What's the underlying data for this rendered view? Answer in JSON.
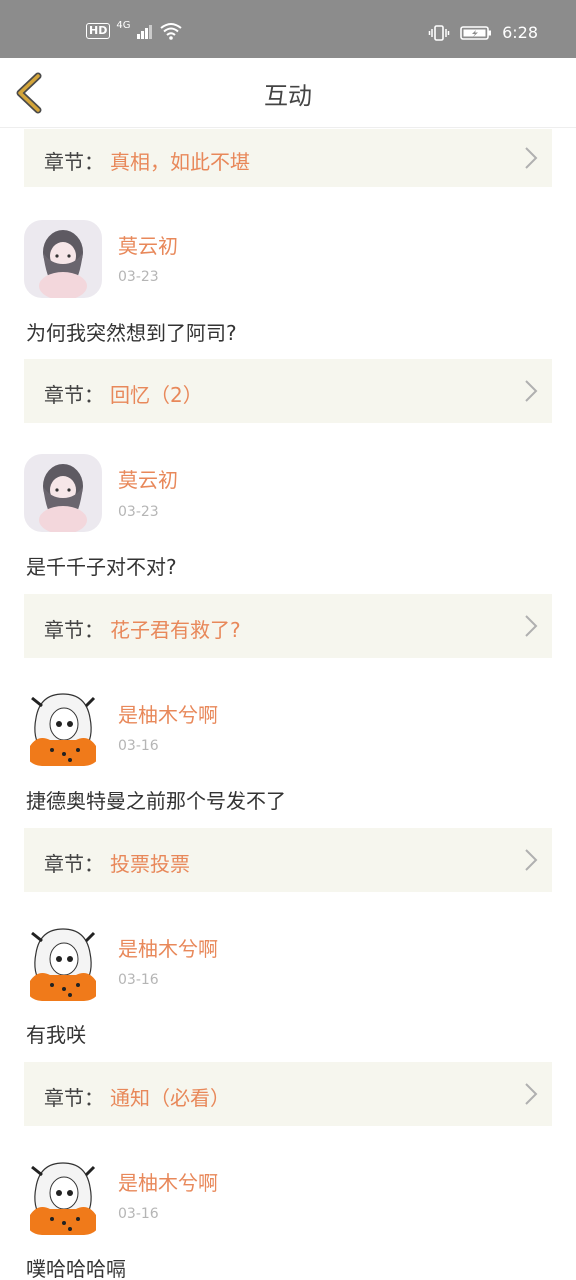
{
  "status_bar": {
    "hd": "HD",
    "network": "4G",
    "time": "6:28"
  },
  "header": {
    "title": "互动"
  },
  "chapter_prefix": "章节：",
  "top_chapter": "真相，如此不堪",
  "comments": [
    {
      "username": "莫云初",
      "date": "03-23",
      "text": "为何我突然想到了阿司?",
      "chapter": "回忆（2）",
      "avatar": "girl-avatar"
    },
    {
      "username": "莫云初",
      "date": "03-23",
      "text": "是千千子对不对?",
      "chapter": "花子君有救了?",
      "avatar": "girl-avatar"
    },
    {
      "username": "是柚木兮啊",
      "date": "03-16",
      "text": "捷德奥特曼之前那个号发不了",
      "chapter": "投票投票",
      "avatar": "anime-avatar"
    },
    {
      "username": "是柚木兮啊",
      "date": "03-16",
      "text": "有我咲",
      "chapter": "通知（必看）",
      "avatar": "anime-avatar"
    },
    {
      "username": "是柚木兮啊",
      "date": "03-16",
      "text": "噗哈哈哈嗝",
      "chapter": "",
      "avatar": "anime-avatar"
    }
  ],
  "colors": {
    "accent": "#e8885a",
    "back_arrow": "#d4a53a",
    "chapter_bg": "#f6f6ee",
    "status_bar": "#8c8c8c"
  }
}
